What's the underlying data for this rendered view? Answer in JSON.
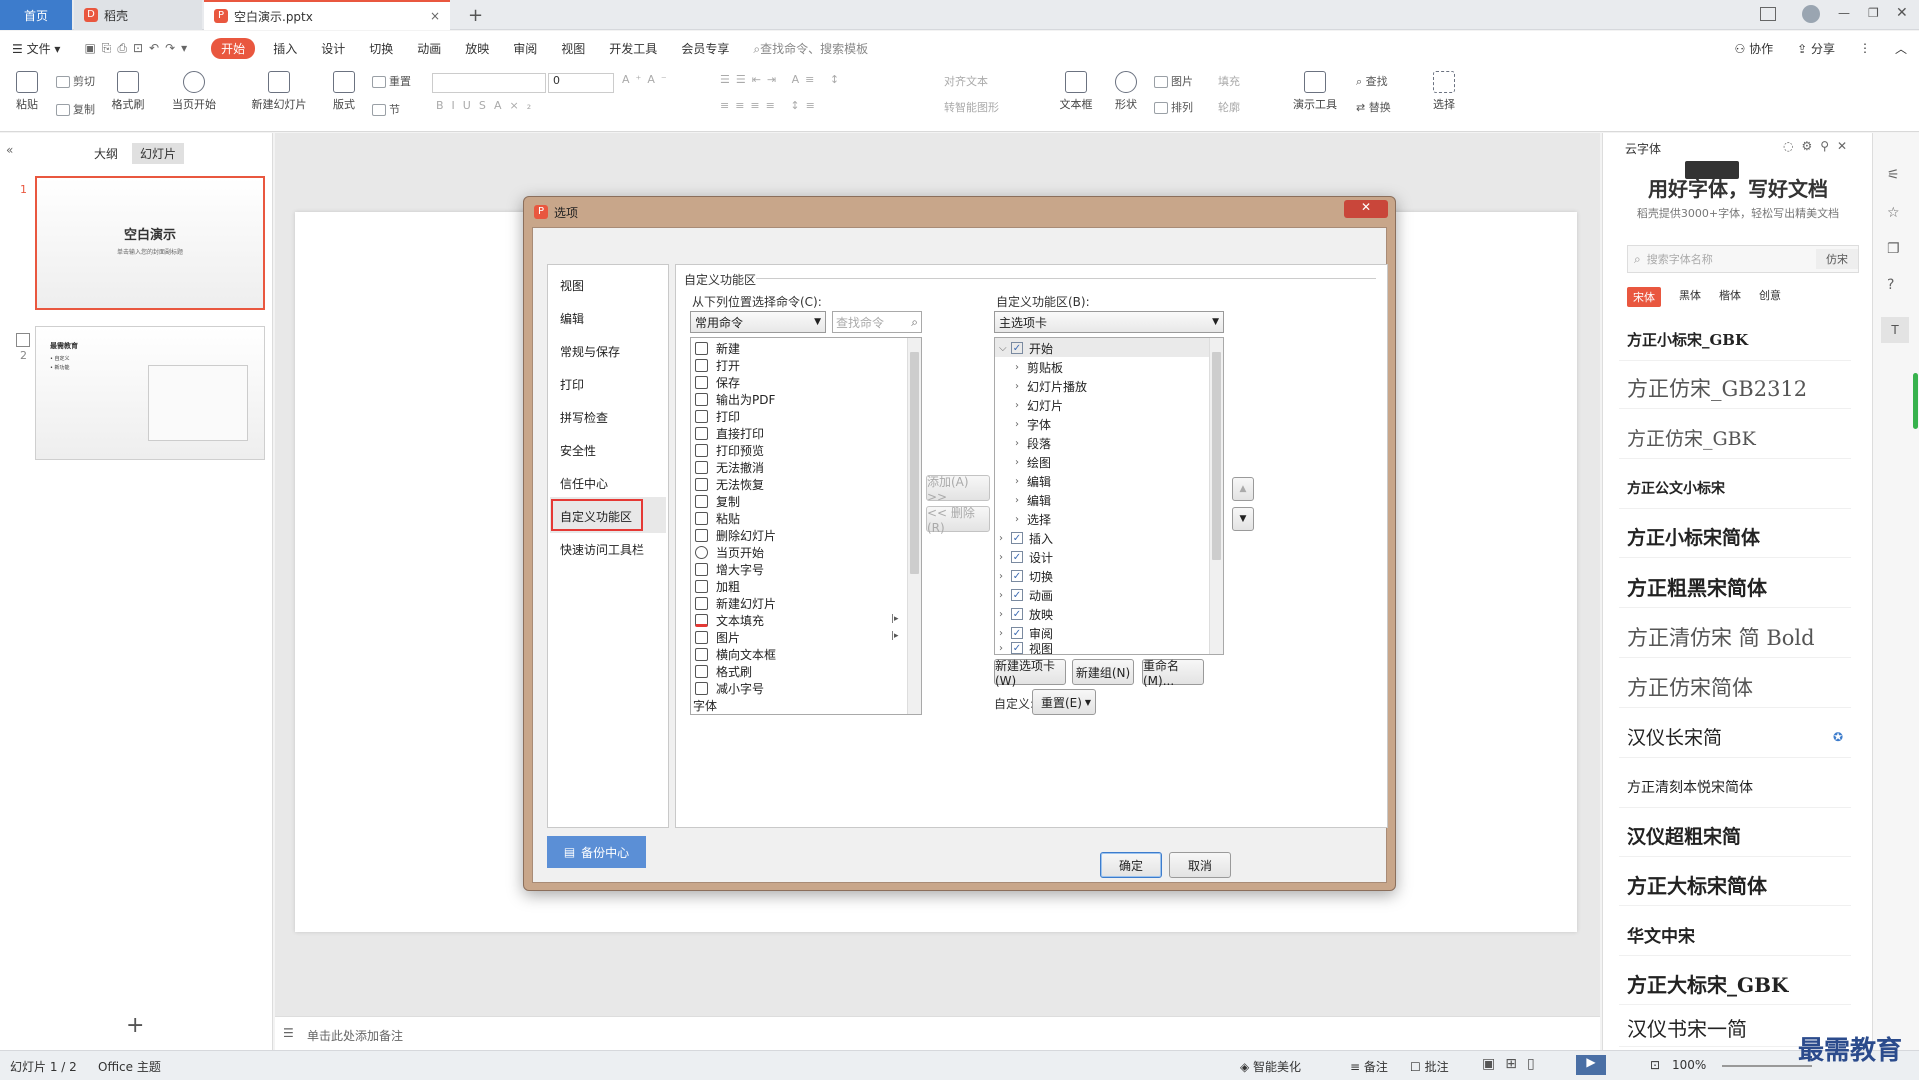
{
  "tabs": {
    "home": "首页",
    "docer": "稻壳",
    "file": "空白演示.pptx",
    "close": "×",
    "add": "+"
  },
  "menu": {
    "file": "文件",
    "items": [
      "开始",
      "插入",
      "设计",
      "切换",
      "动画",
      "放映",
      "审阅",
      "视图",
      "开发工具",
      "会员专享"
    ],
    "search": "查找命令、搜索模板",
    "collab": "协作",
    "share": "分享"
  },
  "ribbon": {
    "paste": "粘贴",
    "cut": "剪切",
    "copy": "复制",
    "format_painter": "格式刷",
    "from_start": "当页开始",
    "new_slide": "新建幻灯片",
    "layout": "版式",
    "reset": "重置",
    "section": "节",
    "font_size": "0",
    "align_text": "对齐文本",
    "smart_shape": "转智能图形",
    "textbox": "文本框",
    "shape": "形状",
    "picture": "图片",
    "fill": "填充",
    "arrange": "排列",
    "outline": "轮廓",
    "present_tool": "演示工具",
    "find": "查找",
    "replace": "替换",
    "select": "选择"
  },
  "left": {
    "tab_outline": "大纲",
    "tab_slides": "幻灯片",
    "slide1_num": "1",
    "slide1_title": "空白演示",
    "slide1_sub": "单击输入您的封面副标题",
    "slide2_num": "2",
    "slide2_title": "最需教育",
    "slide2_l1": "• 自定义",
    "slide2_l2": "• 新功能"
  },
  "notes": "单击此处添加备注",
  "dialog": {
    "title": "选项",
    "nav": [
      "视图",
      "编辑",
      "常规与保存",
      "打印",
      "拼写检查",
      "安全性",
      "信任中心",
      "自定义功能区",
      "快速访问工具栏"
    ],
    "backup": "备份中心",
    "section_title": "自定义功能区",
    "left_label": "从下列位置选择命令(C):",
    "left_combo": "常用命令",
    "search_placeholder": "查找命令",
    "commands": [
      "新建",
      "打开",
      "保存",
      "输出为PDF",
      "打印",
      "直接打印",
      "打印预览",
      "无法撤消",
      "无法恢复",
      "复制",
      "粘贴",
      "删除幻灯片",
      "当页开始",
      "增大字号",
      "加粗",
      "新建幻灯片",
      "文本填充",
      "图片",
      "横向文本框",
      "格式刷",
      "减小字号",
      "字体"
    ],
    "right_label": "自定义功能区(B):",
    "right_combo": "主选项卡",
    "tree_root": "开始",
    "tree_children": [
      "剪贴板",
      "幻灯片播放",
      "幻灯片",
      "字体",
      "段落",
      "绘图",
      "编辑",
      "编辑",
      "选择"
    ],
    "tree_tabs": [
      "插入",
      "设计",
      "切换",
      "动画",
      "放映",
      "审阅",
      "视图"
    ],
    "add_btn": "添加(A) >>",
    "remove_btn": "<< 删除(R)",
    "new_tab": "新建选项卡(W)",
    "new_group": "新建组(N)",
    "rename": "重命名(M)...",
    "custom_label": "自定义:",
    "reset_btn": "重置(E)",
    "ok": "确定",
    "cancel": "取消"
  },
  "fontpanel": {
    "title": "云字体",
    "banner_title": "用好字体，写好文档",
    "banner_sub": "稻壳提供3000+字体，轻松写出精美文档",
    "search_placeholder": "搜索字体名称",
    "search_tag": "仿宋",
    "cats": [
      "宋体",
      "黑体",
      "楷体",
      "创意"
    ],
    "fonts": [
      "方正小标宋_GBK",
      "方正仿宋_GB2312",
      "方正仿宋_GBK",
      "方正公文小标宋",
      "方正小标宋简体",
      "方正粗黑宋简体",
      "方正清仿宋 简 Bold",
      "方正仿宋简体",
      "汉仪长宋简",
      "方正清刻本悦宋简体",
      "汉仪超粗宋简",
      "方正大标宋简体",
      "华文中宋",
      "方正大标宋_GBK",
      "汉仪书宋一简"
    ]
  },
  "status": {
    "slide": "幻灯片 1 / 2",
    "theme": "Office 主题",
    "beautify": "智能美化",
    "notes": "备注",
    "comment": "批注",
    "zoom": "100%"
  },
  "watermark": "最需教育",
  "colors": {
    "accent": "#e9573f",
    "blue": "#3d7ccc",
    "highlight": "#e53935"
  }
}
